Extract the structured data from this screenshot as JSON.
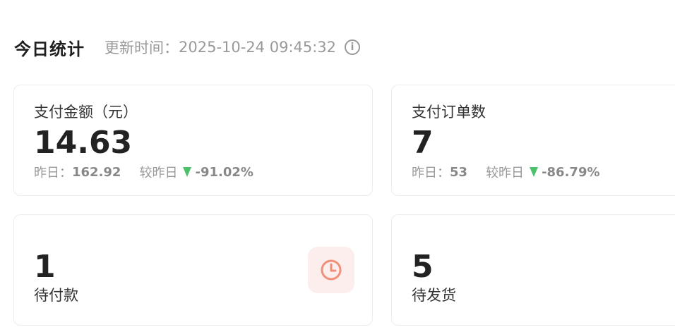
{
  "header": {
    "title": "今日统计",
    "update_label": "更新时间：",
    "update_time": "2025-10-24 09:45:32",
    "info_icon": "info-icon"
  },
  "cards": {
    "payment_amount": {
      "label": "支付金额（元）",
      "value": "14.63",
      "yesterday_label": "昨日：",
      "yesterday_value": "162.92",
      "compare_label": "较昨日",
      "trend": "down",
      "change": "-91.02%"
    },
    "payment_orders": {
      "label": "支付订单数",
      "value": "7",
      "yesterday_label": "昨日：",
      "yesterday_value": "53",
      "compare_label": "较昨日",
      "trend": "down",
      "change": "-86.79%"
    },
    "pending_payment": {
      "label": "待付款",
      "value": "1",
      "icon": "clock-icon"
    },
    "pending_shipment": {
      "label": "待发货",
      "value": "5"
    }
  },
  "colors": {
    "trend_down": "#4cc06b",
    "clock_accent": "#f0907a",
    "clock_bg": "#fdeeee"
  }
}
